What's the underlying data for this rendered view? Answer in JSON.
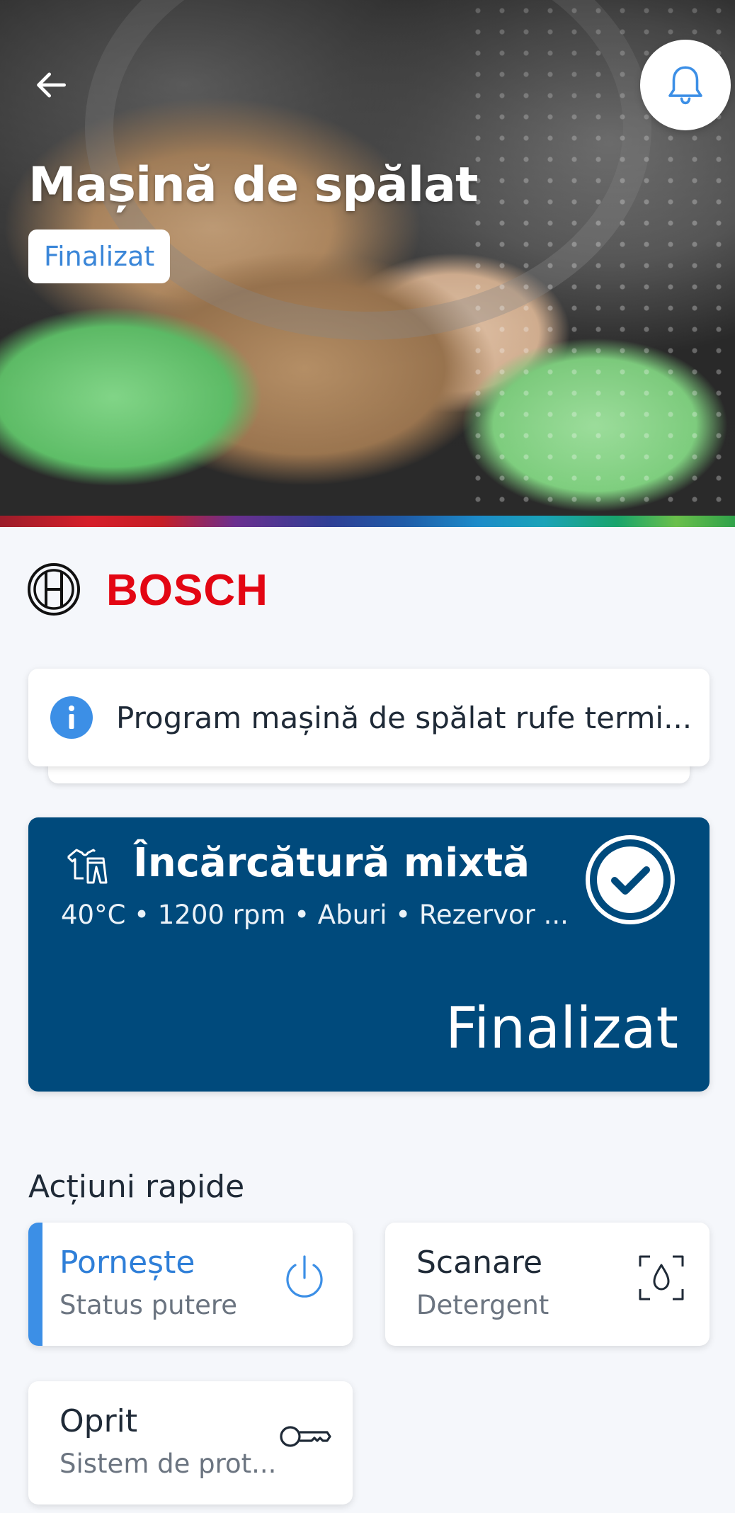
{
  "header": {
    "title": "Mașină de spălat",
    "status_badge": "Finalizat",
    "back_icon": "arrow-left-icon",
    "notification_icon": "bell-icon"
  },
  "brand": {
    "name": "BOSCH",
    "color": "#e30613"
  },
  "notification": {
    "icon": "info-icon",
    "text": "Program mașină de spălat rufe termi..."
  },
  "program": {
    "icon": "mixed-load-icon",
    "name": "Încărcătură mixtă",
    "details": "40°C • 1200 rpm • Aburi • Rezervor ...",
    "status": "Finalizat",
    "status_icon": "check-circle-icon",
    "background_color": "#004a7c"
  },
  "quick_actions": {
    "title": "Acțiuni rapide",
    "items": [
      {
        "title": "Pornește",
        "subtitle": "Status putere",
        "icon": "power-icon",
        "active": true
      },
      {
        "title": "Scanare",
        "subtitle": "Detergent",
        "icon": "scan-drop-icon",
        "active": false
      },
      {
        "title": "Oprit",
        "subtitle": "Sistem de prot...",
        "icon": "key-icon",
        "active": false
      }
    ]
  },
  "colors": {
    "accent": "#3c8fe6",
    "page_background": "#f5f7fb"
  }
}
